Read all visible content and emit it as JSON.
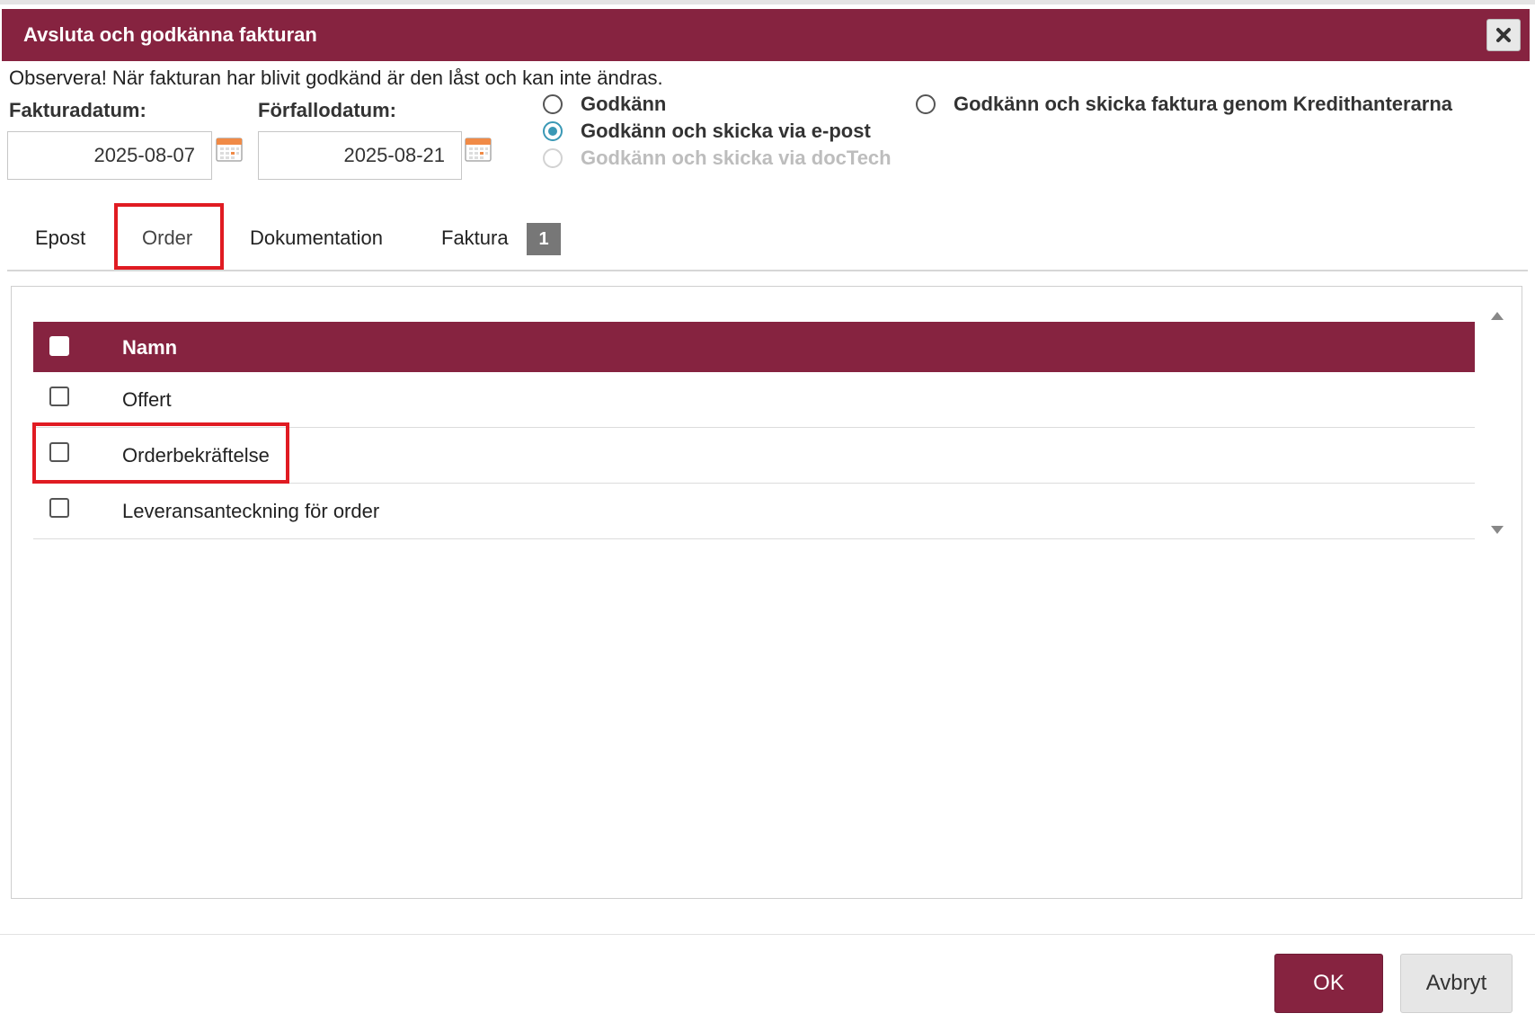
{
  "dialog": {
    "title": "Avsluta och godkänna fakturan",
    "notice": "Observera! När fakturan har blivit godkänd är den låst och kan inte ändras."
  },
  "dates": {
    "invoice_label": "Fakturadatum:",
    "invoice_value": "2025-08-07",
    "due_label": "Förfallodatum:",
    "due_value": "2025-08-21"
  },
  "approval": {
    "options": [
      {
        "label": "Godkänn",
        "checked": false,
        "disabled": false
      },
      {
        "label": "Godkänn och skicka via e-post",
        "checked": true,
        "disabled": false
      },
      {
        "label": "Godkänn och skicka via docTech",
        "checked": false,
        "disabled": true
      },
      {
        "label": "Godkänn och skicka faktura genom Kredithanterarna",
        "checked": false,
        "disabled": false
      }
    ]
  },
  "tabs": [
    {
      "label": "Epost"
    },
    {
      "label": "Order",
      "active": true
    },
    {
      "label": "Dokumentation"
    },
    {
      "label": "Faktura",
      "badge": "1"
    }
  ],
  "table": {
    "header_name": "Namn",
    "rows": [
      {
        "name": "Offert",
        "checked": false
      },
      {
        "name": "Orderbekräftelse",
        "checked": false
      },
      {
        "name": "Leveransanteckning för order",
        "checked": false
      }
    ]
  },
  "buttons": {
    "ok": "OK",
    "cancel": "Avbryt"
  },
  "colors": {
    "brand": "#862340",
    "radio_checked": "#3a98b5",
    "highlight": "#e01b22"
  },
  "icons": {
    "close": "close-icon",
    "calendar": "calendar-icon"
  }
}
